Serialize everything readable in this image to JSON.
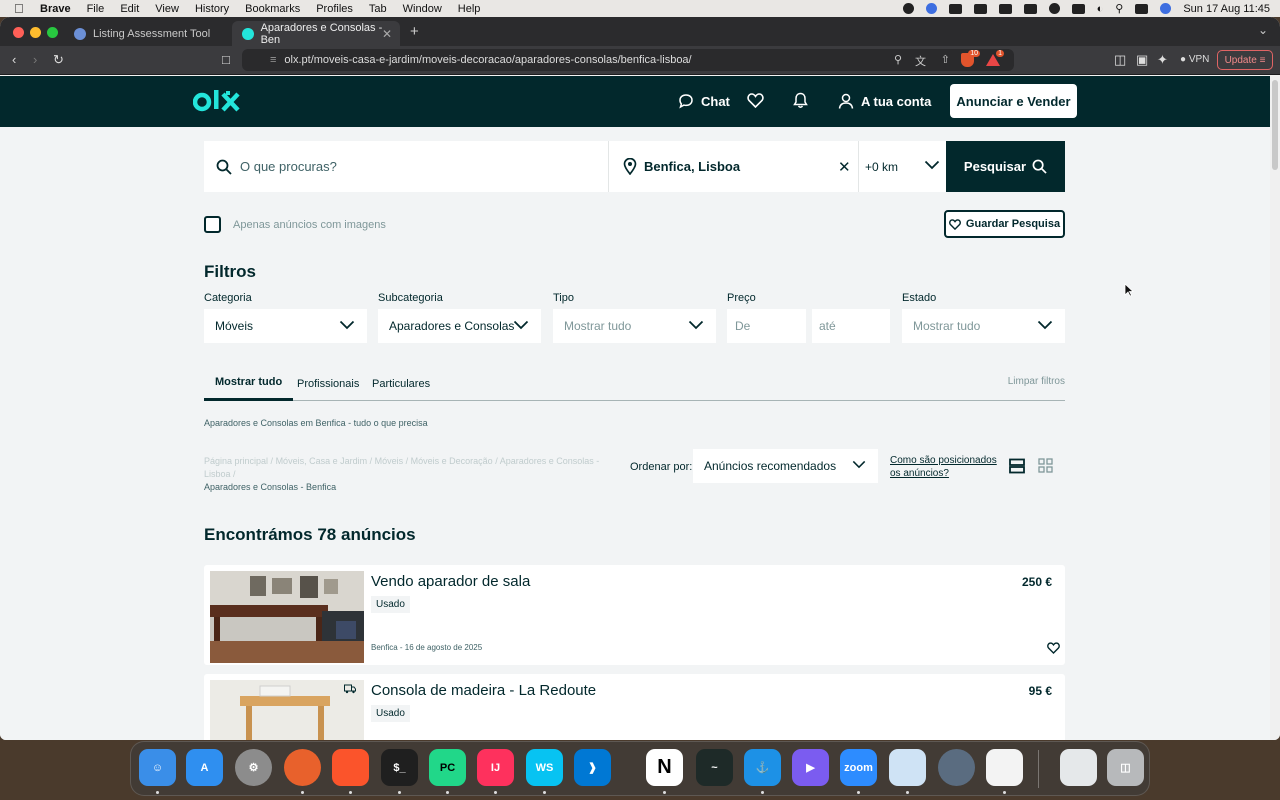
{
  "menubar": {
    "app": "Brave",
    "items": [
      "File",
      "Edit",
      "View",
      "History",
      "Bookmarks",
      "Profiles",
      "Tab",
      "Window",
      "Help"
    ],
    "datetime": "Sun 17 Aug  11:45"
  },
  "browser": {
    "tabs": [
      {
        "label": "Listing Assessment Tool"
      },
      {
        "label": "Aparadores e Consolas - Ben"
      }
    ],
    "url": "olx.pt/moveis-casa-e-jardim/moveis-decoracao/aparadores-consolas/benfica-lisboa/",
    "shield_count": "10",
    "alert_count": "1",
    "vpn_label": "VPN",
    "update_label": "Update"
  },
  "header": {
    "chat_label": "Chat",
    "account_label": "A tua conta",
    "post_button": "Anunciar e Vender"
  },
  "search": {
    "query_placeholder": "O que procuras?",
    "location": "Benfica, Lisboa",
    "radius": "+0 km",
    "button": "Pesquisar"
  },
  "options": {
    "only_images": "Apenas anúncios com imagens",
    "save_search": "Guardar Pesquisa"
  },
  "filters": {
    "title": "Filtros",
    "category": {
      "label": "Categoria",
      "value": "Móveis"
    },
    "subcategory": {
      "label": "Subcategoria",
      "value": "Aparadores e Consolas"
    },
    "type": {
      "label": "Tipo",
      "placeholder": "Mostrar tudo"
    },
    "price": {
      "label": "Preço",
      "from_placeholder": "De",
      "to_placeholder": "até"
    },
    "state": {
      "label": "Estado",
      "placeholder": "Mostrar tudo"
    }
  },
  "segments": {
    "tabs": [
      "Mostrar tudo",
      "Profissionais",
      "Particulares"
    ],
    "clear": "Limpar filtros"
  },
  "listing_info": {
    "category_desc": "Aparadores e Consolas em Benfica - tudo o que precisa",
    "breadcrumbs": [
      "Página principal",
      "Móveis, Casa e Jardim",
      "Móveis",
      "Móveis e Decoração",
      "Aparadores e Consolas - Lisboa"
    ],
    "breadcrumb_last": "Aparadores e Consolas - Benfica",
    "sort_label": "Ordenar por:",
    "sort_value": "Anúncios recomendados",
    "how_positioned": "Como são posicionados os anúncios?",
    "results_title": "Encontrámos 78 anúncios"
  },
  "ads": [
    {
      "title": "Vendo aparador de sala",
      "condition": "Usado",
      "price": "250 €",
      "meta": "Benfica - 16 de agosto de 2025"
    },
    {
      "title": "Consola de madeira - La Redoute",
      "condition": "Usado",
      "price": "95 €",
      "meta": ""
    }
  ],
  "colors": {
    "brand_dark": "#02282c",
    "brand_accent": "#23e5db",
    "page_bg": "#f2f4f5"
  },
  "dock_apps": [
    "finder-icon",
    "app-store-icon",
    "system-settings-icon",
    "firefox-icon",
    "brave-icon",
    "terminal-icon",
    "pycharm-icon",
    "intellij-icon",
    "webstorm-icon",
    "vscode-icon",
    "notion-icon",
    "activity-monitor-icon",
    "docker-icon",
    "linear-icon",
    "zoom-icon",
    "preview-icon",
    "quicktime-icon",
    "textedit-icon",
    "document-icon",
    "trash-icon"
  ]
}
